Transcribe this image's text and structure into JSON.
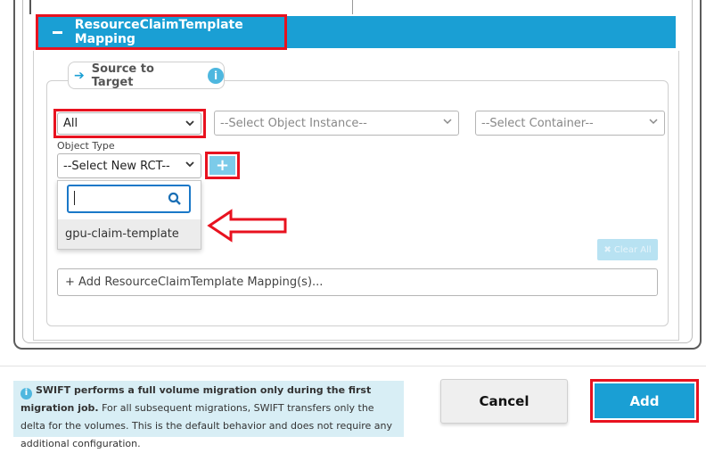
{
  "accordion": {
    "title": "ResourceClaimTemplate Mapping"
  },
  "tab": {
    "label": "Source to Target",
    "info_icon": "i"
  },
  "filters": {
    "scope_value": "All",
    "object_instance_placeholder": "--Select Object Instance--",
    "container_placeholder": "--Select Container--"
  },
  "object_type": {
    "label": "Object Type",
    "value": "--Select New RCT--",
    "add_icon": "+"
  },
  "dropdown": {
    "search_value": "",
    "options": [
      "gpu-claim-template"
    ]
  },
  "clear_all_label": "✖ Clear All",
  "add_mapping_label": "+ Add ResourceClaimTemplate Mapping(s)...",
  "notice": {
    "icon": "i",
    "bold_text": "SWIFT performs a full volume migration only during the first migration job.",
    "text": " For all subsequent migrations, SWIFT transfers only the delta for the volumes. This is the default behavior and does not require any additional configuration."
  },
  "buttons": {
    "cancel": "Cancel",
    "add": "Add"
  },
  "colors": {
    "accent": "#1a9fd4",
    "highlight": "#e8121f",
    "notice_bg": "#d8eef5"
  }
}
